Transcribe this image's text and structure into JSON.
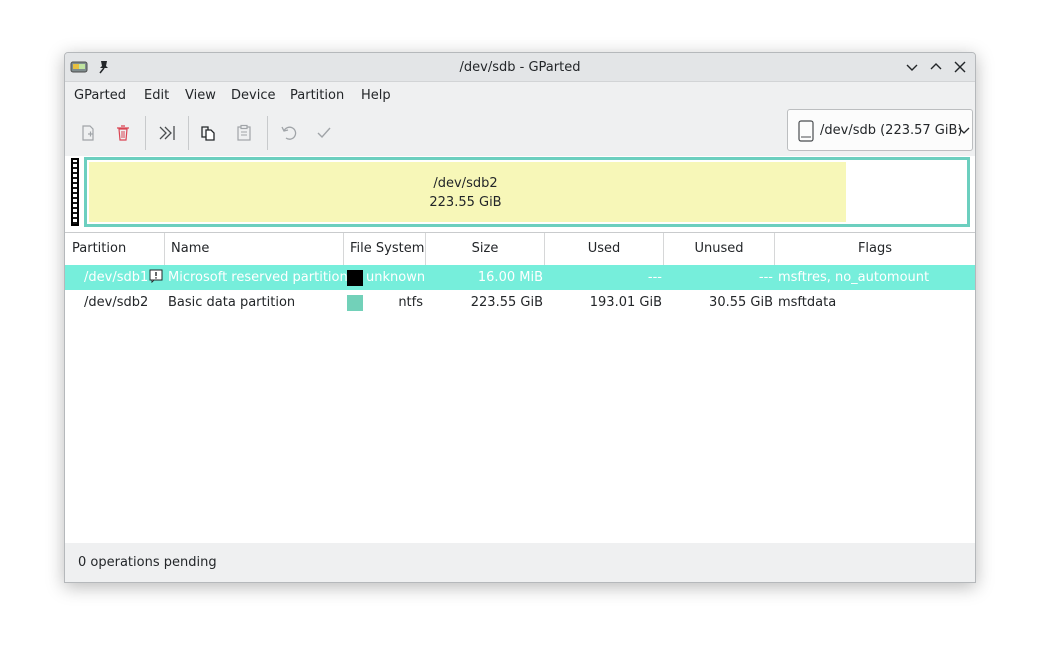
{
  "window": {
    "title": "/dev/sdb - GParted"
  },
  "menu": [
    "GParted",
    "Edit",
    "View",
    "Device",
    "Partition",
    "Help"
  ],
  "toolbar": {
    "icons": [
      "new-partition-icon",
      "delete-partition-icon",
      "resize-move-icon",
      "copy-icon",
      "paste-icon",
      "undo-icon",
      "apply-icon"
    ]
  },
  "device": {
    "label": "/dev/sdb (223.57 GiB)"
  },
  "diskmap": {
    "partition": "/dev/sdb2",
    "size": "223.55 GiB",
    "used_fraction": 0.864
  },
  "table": {
    "headers": [
      "Partition",
      "Name",
      "File System",
      "Size",
      "Used",
      "Unused",
      "Flags"
    ],
    "rows": [
      {
        "partition": "/dev/sdb1",
        "name": "Microsoft reserved partition",
        "fs_color": "#000000",
        "fs": "unknown",
        "size": "16.00 MiB",
        "used": "---",
        "unused": "---",
        "flags": "msftres, no_automount",
        "selected": true
      },
      {
        "partition": "/dev/sdb2",
        "name": "Basic data partition",
        "fs_color": "#72d1b9",
        "fs": "ntfs",
        "size": "223.55 GiB",
        "used": "193.01 GiB",
        "unused": "30.55 GiB",
        "flags": "msftdata",
        "selected": false
      }
    ]
  },
  "status": "0 operations pending",
  "colors": {
    "accent": "#76eedb",
    "partition_border": "#6ccfbf",
    "used_fill": "#f7f7b8",
    "delete_red": "#da4453"
  }
}
